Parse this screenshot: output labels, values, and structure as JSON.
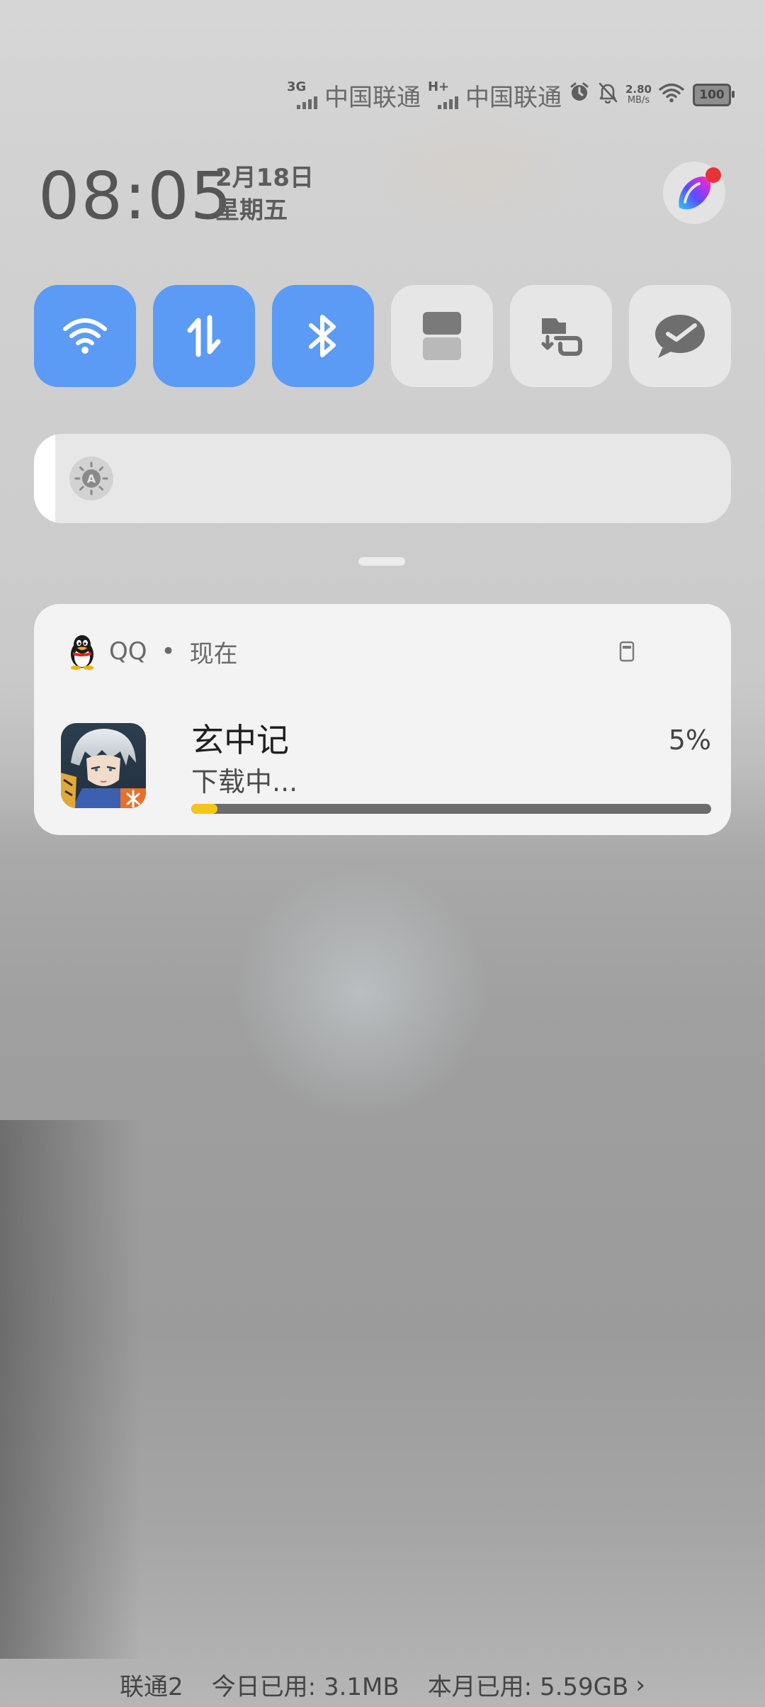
{
  "status_bar": {
    "sim1_network": "3G",
    "sim1_carrier": "中国联通",
    "sim2_network": "H+",
    "sim2_carrier": "中国联通",
    "speed_value": "2.80",
    "speed_unit": "MB/s",
    "battery": "100"
  },
  "header": {
    "time": "08:05",
    "date": "2月18日",
    "weekday": "星期五"
  },
  "quick_tiles": [
    {
      "name": "wifi-icon",
      "on": true
    },
    {
      "name": "mobile-data-icon",
      "on": true
    },
    {
      "name": "bluetooth-icon",
      "on": true
    },
    {
      "name": "split-screen-icon",
      "on": false
    },
    {
      "name": "screen-rotation-icon",
      "on": false
    },
    {
      "name": "message-icon",
      "on": false
    }
  ],
  "brightness": {
    "level": 0.03,
    "auto_label": "A"
  },
  "notification": {
    "app_name": "QQ",
    "separator": "•",
    "time": "现在",
    "title": "玄中记",
    "subtitle": "下载中...",
    "percent": "5%",
    "progress": 0.05
  },
  "footer": {
    "sim_label": "联通2",
    "today_usage": "今日已用: 3.1MB",
    "month_usage": "本月已用: 5.59GB",
    "chevron": "›"
  },
  "colors": {
    "tile_on": "#5b9bf5",
    "tile_off": "#e6e6e6",
    "progress_fill": "#f5c518",
    "progress_track": "#6c6c6c"
  }
}
